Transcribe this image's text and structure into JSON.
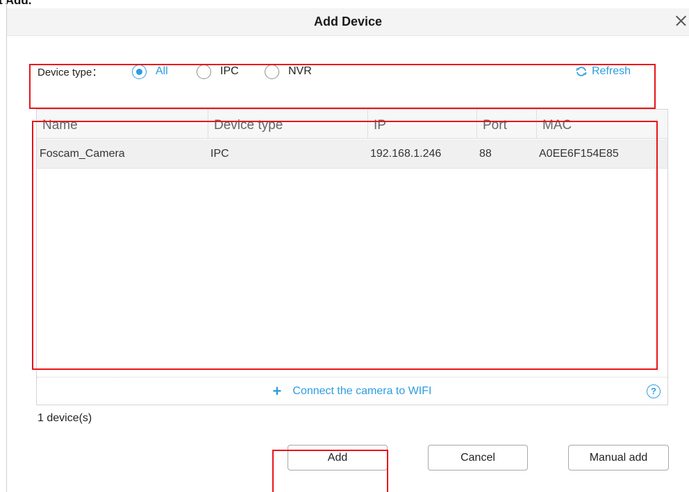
{
  "page": {
    "fragment_text": "t Add."
  },
  "dialog": {
    "title": "Add Device"
  },
  "filter": {
    "label": "Device type：",
    "options": [
      {
        "label": "All",
        "checked": true
      },
      {
        "label": "IPC",
        "checked": false
      },
      {
        "label": "NVR",
        "checked": false
      }
    ],
    "refresh_label": "Refresh"
  },
  "table": {
    "columns": [
      "Name",
      "Device type",
      "IP",
      "Port",
      "MAC"
    ],
    "rows": [
      {
        "name": "Foscam_Camera",
        "device_type": "IPC",
        "ip": "192.168.1.246",
        "port": "88",
        "mac": "A0EE6F154E85"
      }
    ],
    "wifi_link_label": "Connect the camera to WIFI",
    "help_icon": "?"
  },
  "status": {
    "device_count": "1 device(s)"
  },
  "buttons": {
    "add": "Add",
    "cancel": "Cancel",
    "manual_add": "Manual add"
  },
  "colors": {
    "accent": "#2b9de0",
    "annotation": "#e8131a"
  }
}
